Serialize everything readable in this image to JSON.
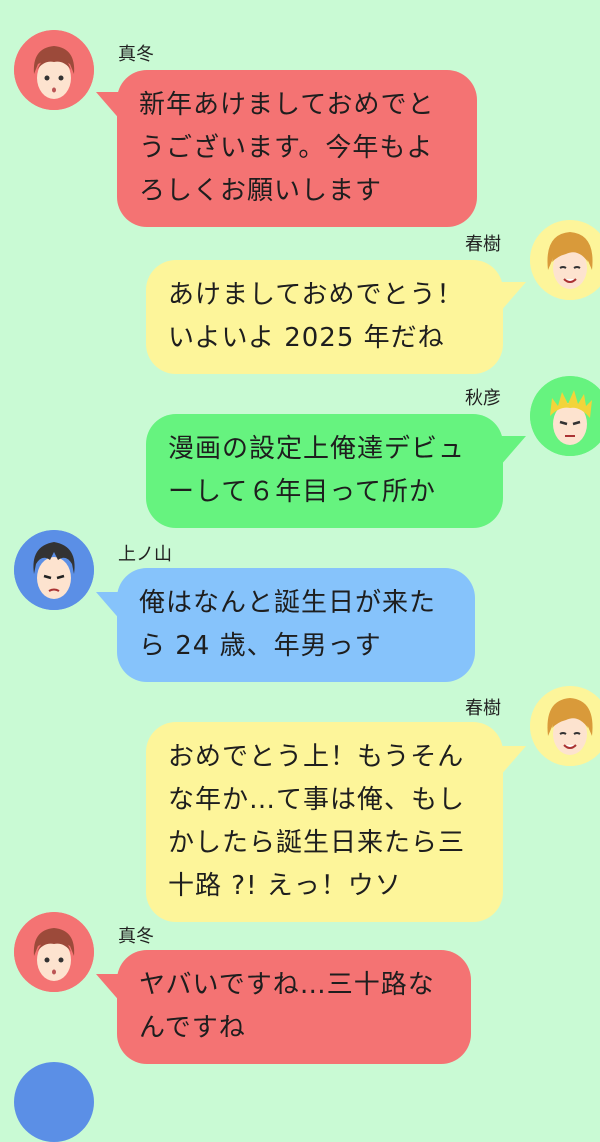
{
  "messages": [
    {
      "speaker": "真冬",
      "lines": [
        "新年あけましておめでと",
        "うございます。今年もよ",
        "ろしくお願いします"
      ],
      "color": "#f47373",
      "avatar": "mafuyu-avatar-icon"
    },
    {
      "speaker": "春樹",
      "lines": [
        "あけましておめでとう！",
        "いよいよ 2025 年だね"
      ],
      "color": "#fdf59a",
      "avatar": "haruki-avatar-icon"
    },
    {
      "speaker": "秋彦",
      "lines": [
        "漫画の設定上俺達デビュ",
        "ーして６年目って所か"
      ],
      "color": "#66f37f",
      "avatar": "akihiko-avatar-icon"
    },
    {
      "speaker": "上ノ山",
      "lines": [
        "俺はなんと誕生日が来た",
        "ら 24 歳、年男っす"
      ],
      "color": "#86c3fb",
      "avatar": "uenoyama-avatar-icon"
    },
    {
      "speaker": "春樹",
      "lines": [
        "おめでとう上！もうそん",
        "な年か…て事は俺、もし",
        "かしたら誕生日来たら三",
        "十路 ?! えっ！ウソ"
      ],
      "color": "#fdf59a",
      "avatar": "haruki-avatar-icon"
    },
    {
      "speaker": "真冬",
      "lines": [
        "ヤバいですね…三十路な",
        "んですね"
      ],
      "color": "#f47373",
      "avatar": "mafuyu-avatar-icon"
    }
  ]
}
